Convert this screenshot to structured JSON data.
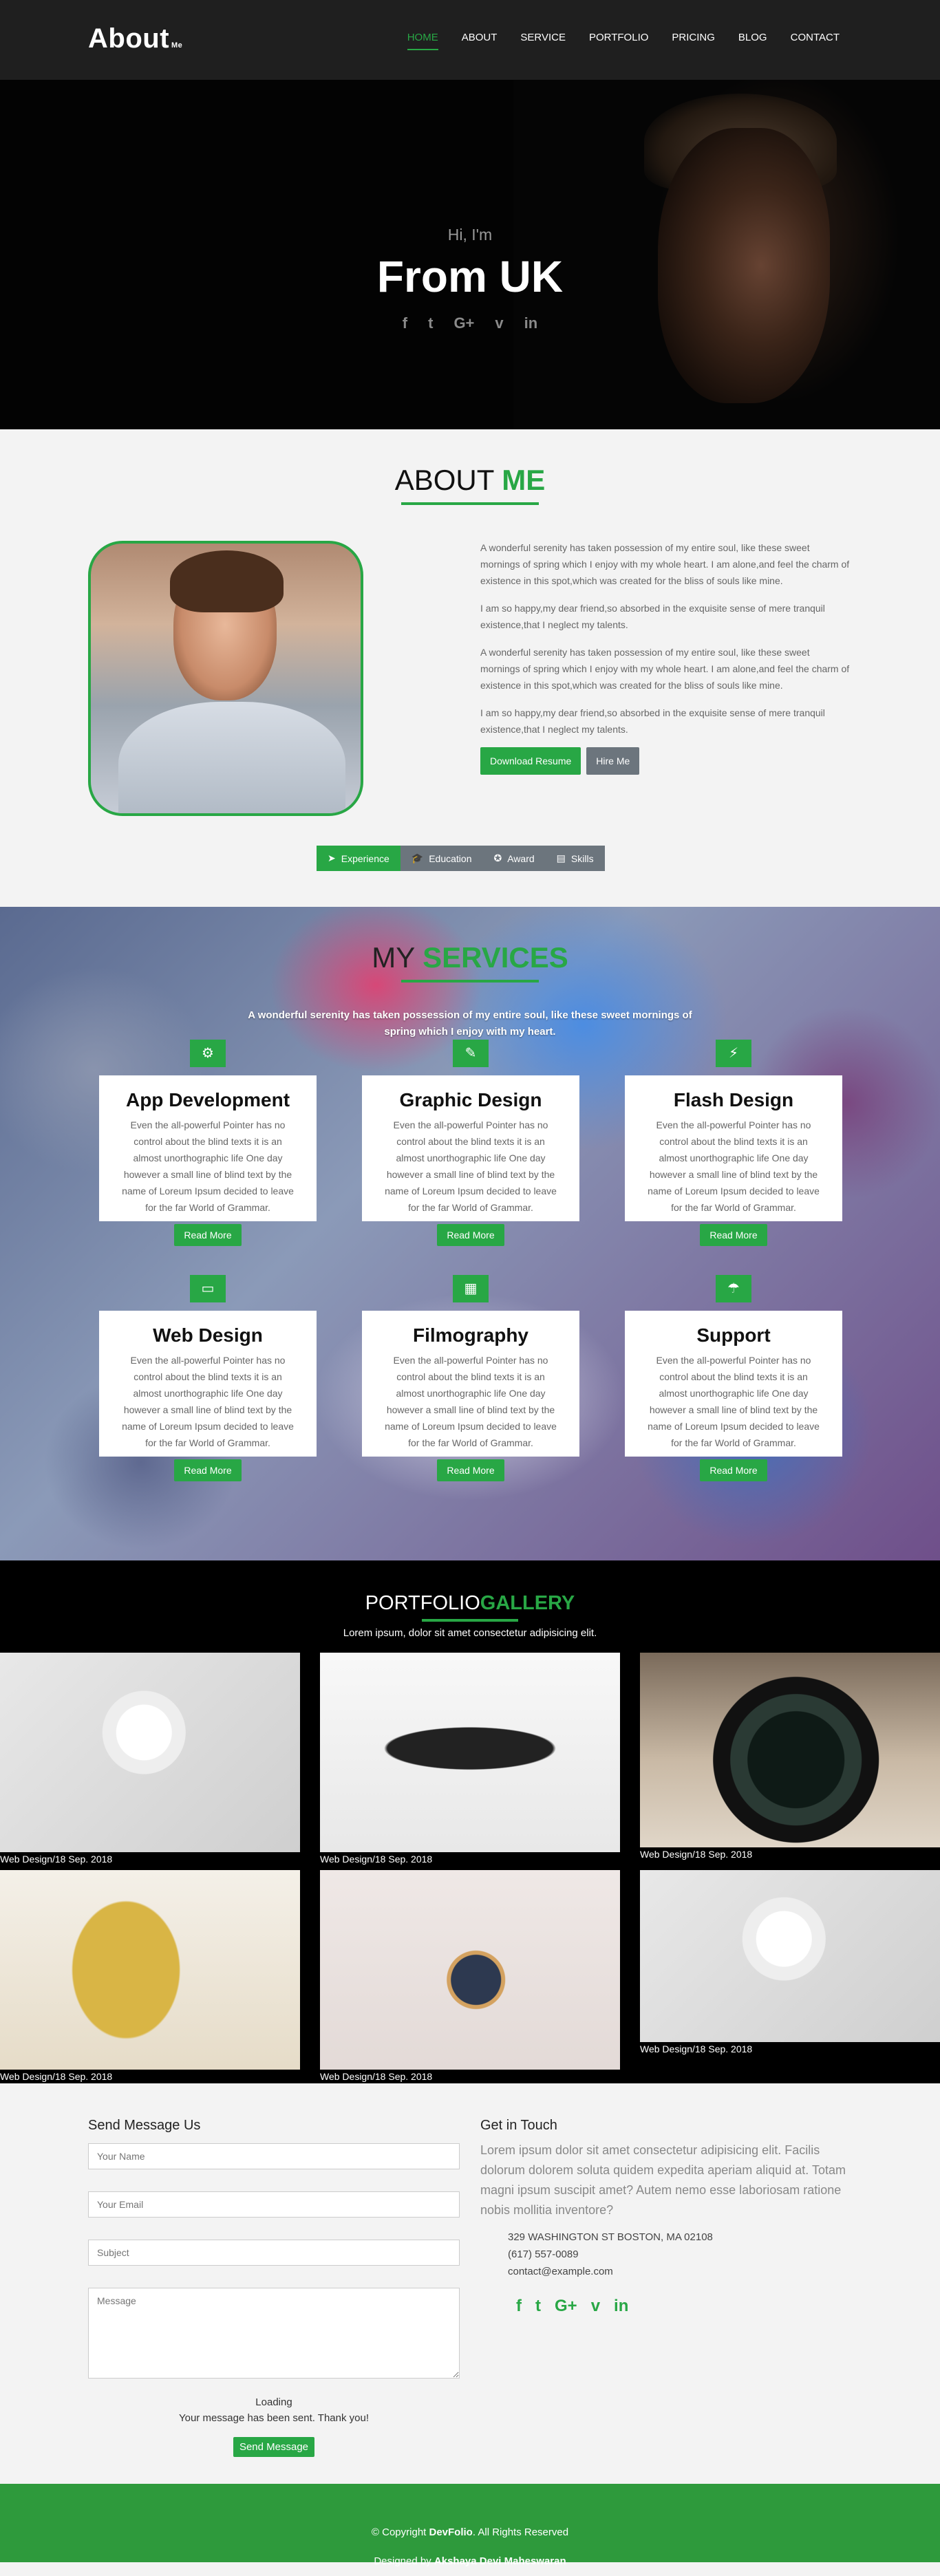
{
  "nav": {
    "logo": "About",
    "logo_suffix": "Me",
    "links": [
      "HOME",
      "ABOUT",
      "SERVICE",
      "PORTFOLIO",
      "PRICING",
      "BLOG",
      "CONTACT"
    ]
  },
  "hero": {
    "greeting": "Hi, I'm",
    "title": "From UK",
    "social": [
      "f",
      "t",
      "G+",
      "v",
      "in"
    ]
  },
  "about": {
    "title_a": "ABOUT",
    "title_b": "ME",
    "paragraphs": [
      "A wonderful serenity has taken possession of my entire soul, like these sweet mornings of spring which I enjoy with my whole heart. I am alone,and feel the charm of existence in this spot,which was created for the bliss of souls like mine.",
      "I am so happy,my dear friend,so absorbed in the exquisite sense of mere tranquil existence,that I neglect my talents.",
      "A wonderful serenity has taken possession of my entire soul, like these sweet mornings of spring which I enjoy with my whole heart. I am alone,and feel the charm of existence in this spot,which was created for the bliss of souls like mine.",
      "I am so happy,my dear friend,so absorbed in the exquisite sense of mere tranquil existence,that I neglect my talents."
    ],
    "download_btn": "Download Resume",
    "hire_btn": "Hire Me",
    "tabs": [
      "Experience",
      "Education",
      "Award",
      "Skills"
    ]
  },
  "services": {
    "title_a": "MY",
    "title_b": "SERVICES",
    "subtitle": "A wonderful serenity has taken possession of my entire soul, like these sweet mornings of spring which I enjoy with my heart.",
    "items": [
      {
        "title": "App Development",
        "icon": "gear-icon",
        "glyph": "⚙",
        "text": "Even the all-powerful Pointer has no control about the blind texts it is an almost unorthographic life One day however a small line of blind text by the name of Loreum Ipsum decided to leave for the far World of Grammar.",
        "btn": "Read More"
      },
      {
        "title": "Graphic Design",
        "icon": "brush-icon",
        "glyph": "✎",
        "text": "Even the all-powerful Pointer has no control about the blind texts it is an almost unorthographic life One day however a small line of blind text by the name of Loreum Ipsum decided to leave for the far World of Grammar.",
        "btn": "Read More"
      },
      {
        "title": "Flash Design",
        "icon": "flash-icon",
        "glyph": "⚡",
        "text": "Even the all-powerful Pointer has no control about the blind texts it is an almost unorthographic life One day however a small line of blind text by the name of Loreum Ipsum decided to leave for the far World of Grammar.",
        "btn": "Read More"
      },
      {
        "title": "Web Design",
        "icon": "monitor-icon",
        "glyph": "▭",
        "text": "Even the all-powerful Pointer has no control about the blind texts it is an almost unorthographic life One day however a small line of blind text by the name of Loreum Ipsum decided to leave for the far World of Grammar.",
        "btn": "Read More"
      },
      {
        "title": "Filmography",
        "icon": "film-icon",
        "glyph": "▦",
        "text": "Even the all-powerful Pointer has no control about the blind texts it is an almost unorthographic life One day however a small line of blind text by the name of Loreum Ipsum decided to leave for the far World of Grammar.",
        "btn": "Read More"
      },
      {
        "title": "Support",
        "icon": "umbrella-icon",
        "glyph": "☂",
        "text": "Even the all-powerful Pointer has no control about the blind texts it is an almost unorthographic life One day however a small line of blind text by the name of Loreum Ipsum decided to leave for the far World of Grammar.",
        "btn": "Read More"
      }
    ]
  },
  "portfolio": {
    "title_a": "PORTFOLIO",
    "title_b": "GALLERY",
    "subtitle": "Lorem ipsum, dolor sit amet consectetur adipisicing elit.",
    "items": [
      {
        "caption": "Web Design/18 Sep. 2018"
      },
      {
        "caption": "Web Design/18 Sep. 2018"
      },
      {
        "caption": "Web Design/18 Sep. 2018"
      },
      {
        "caption": "Web Design/18 Sep. 2018"
      },
      {
        "caption": "Web Design/18 Sep. 2018"
      },
      {
        "caption": "Web Design/18 Sep. 2018"
      }
    ]
  },
  "contact": {
    "form_title": "Send Message Us",
    "name_placeholder": "Your Name",
    "email_placeholder": "Your Email",
    "subject_placeholder": "Subject",
    "message_placeholder": "Message",
    "loading": "Loading",
    "sent": "Your message has been sent. Thank you!",
    "send_btn": "Send Message",
    "info_title": "Get in Touch",
    "info_text": "Lorem ipsum dolor sit amet consectetur adipisicing elit. Facilis dolorum dolorem soluta quidem expedita aperiam aliquid at. Totam magni ipsum suscipit amet? Autem nemo esse laboriosam ratione nobis mollitia inventore?",
    "address": "329 WASHINGTON ST BOSTON, MA 02108",
    "phone": "(617) 557-0089",
    "email": "contact@example.com",
    "social": [
      "f",
      "t",
      "G+",
      "v",
      "in"
    ]
  },
  "footer": {
    "copyright_prefix": "© Copyright",
    "brand": "DevFolio",
    "copyright_suffix": ". All Rights Reserved",
    "designed_prefix": "Designed by",
    "designer": "Akshaya Devi Maheswaran"
  },
  "colors": {
    "accent": "#28a745",
    "nav_bg": "#1f1f1f",
    "footer_bg": "#2e9a3c"
  }
}
